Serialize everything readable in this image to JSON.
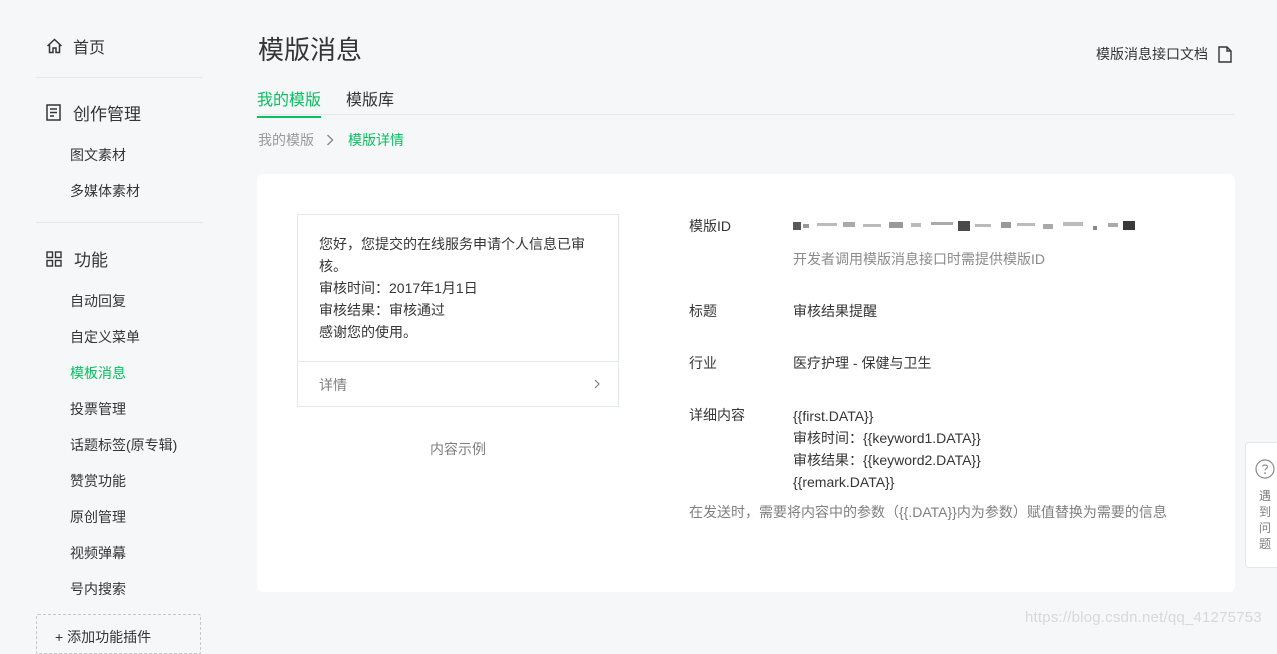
{
  "sidebar": {
    "home_label": "首页",
    "sections": [
      {
        "title": "创作管理",
        "items": [
          "图文素材",
          "多媒体素材"
        ]
      },
      {
        "title": "功能",
        "items": [
          "自动回复",
          "自定义菜单",
          "模板消息",
          "投票管理",
          "话题标签(原专辑)",
          "赞赏功能",
          "原创管理",
          "视频弹幕",
          "号内搜索"
        ]
      }
    ],
    "active_item": "模板消息",
    "add_plugin_label": "+ 添加功能插件"
  },
  "header": {
    "title": "模版消息",
    "doc_link_label": "模版消息接口文档"
  },
  "tabs": [
    {
      "label": "我的模版",
      "active": true
    },
    {
      "label": "模版库",
      "active": false
    }
  ],
  "breadcrumb": {
    "parent": "我的模版",
    "current": "模版详情"
  },
  "preview": {
    "lines": [
      "您好，您提交的在线服务申请个人信息已审核。",
      "审核时间：2017年1月1日",
      "审核结果：审核通过",
      "感谢您的使用。"
    ],
    "footer_label": "详情",
    "caption": "内容示例"
  },
  "details": {
    "id_label": "模版ID",
    "id_hint": "开发者调用模版消息接口时需提供模版ID",
    "title_label": "标题",
    "title_value": "审核结果提醒",
    "industry_label": "行业",
    "industry_value": "医疗护理 - 保健与卫生",
    "content_label": "详细内容",
    "content_lines": [
      "{{first.DATA}}",
      "审核时间：{{keyword1.DATA}}",
      "审核结果：{{keyword2.DATA}}",
      "{{remark.DATA}}"
    ],
    "note": "在发送时，需要将内容中的参数（{{.DATA}}内为参数）赋值替换为需要的信息"
  },
  "help_widget": {
    "label": "遇到问题"
  },
  "watermark": "https://blog.csdn.net/qq_41275753",
  "colors": {
    "accent": "#07c160",
    "background": "#f6f7f8",
    "card": "#ffffff"
  }
}
